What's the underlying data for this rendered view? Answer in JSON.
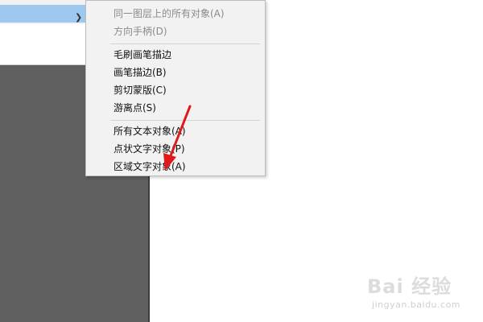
{
  "parent_menu": {
    "arrow_icon": "chevron-right-icon"
  },
  "submenu": {
    "items": [
      {
        "label": "同一图层上的所有对象(A)",
        "enabled": false
      },
      {
        "label": "方向手柄(D)",
        "enabled": false
      },
      {
        "label": "毛刷画笔描边",
        "enabled": true
      },
      {
        "label": "画笔描边(B)",
        "enabled": true
      },
      {
        "label": "剪切蒙版(C)",
        "enabled": true
      },
      {
        "label": "游离点(S)",
        "enabled": true
      },
      {
        "label": "所有文本对象(A)",
        "enabled": true
      },
      {
        "label": "点状文字对象(P)",
        "enabled": true
      },
      {
        "label": "区域文字对象(A)",
        "enabled": true
      }
    ]
  },
  "annotation": {
    "color": "#e0191b",
    "icon": "red-arrow-icon"
  },
  "watermark": {
    "main": "Bai 经验",
    "sub": "jingyan.baidu.com"
  }
}
